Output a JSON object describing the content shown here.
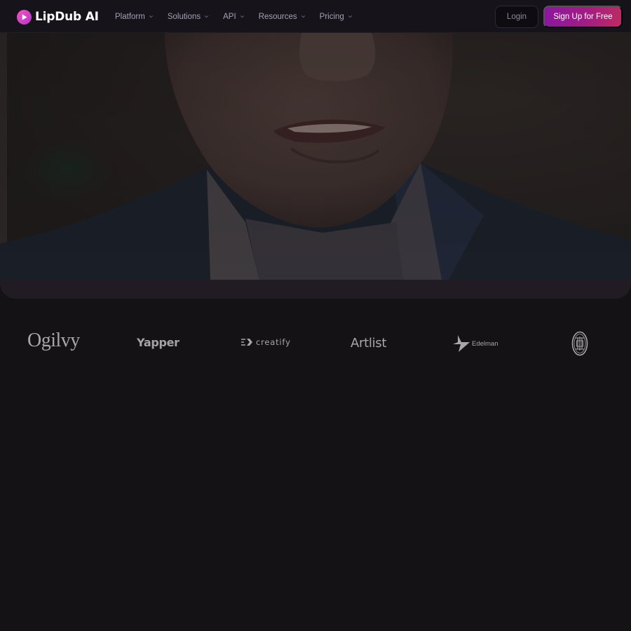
{
  "header": {
    "brand_name": "LipDub AI",
    "nav": [
      {
        "label": "Platform",
        "icon": "chevron-down-icon"
      },
      {
        "label": "Solutions",
        "icon": "chevron-down-icon"
      },
      {
        "label": "API",
        "icon": "chevron-down-icon"
      },
      {
        "label": "Resources",
        "icon": "chevron-down-icon"
      },
      {
        "label": "Pricing",
        "icon": "chevron-down-icon"
      }
    ],
    "login_label": "Login",
    "signup_label": "Sign Up for Free"
  },
  "hero": {
    "media": "speaker-video-still"
  },
  "clients": {
    "logos": [
      {
        "name": "Ogilvy",
        "text": "Ogilvy"
      },
      {
        "name": "Yapper",
        "text": "Yapper"
      },
      {
        "name": "Creatify",
        "text": "creatify"
      },
      {
        "name": "Artlist",
        "text": "Artlist"
      },
      {
        "name": "Edelman",
        "text": "Edelman"
      },
      {
        "name": "AC Milan",
        "text": ""
      }
    ]
  },
  "colors": {
    "background": "#141215",
    "navbar": "#16131a",
    "brand_accent": "#d33fc2",
    "signup_gradient_start": "#8a179e",
    "signup_gradient_end": "#bd2a63",
    "logo_gray": "#a8a6aa"
  }
}
